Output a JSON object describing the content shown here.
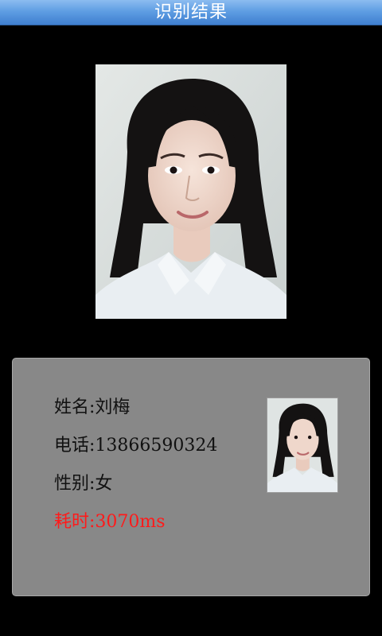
{
  "header": {
    "title": "识别结果"
  },
  "result": {
    "name_label": "姓名:",
    "name_value": "刘梅",
    "phone_label": "电话:",
    "phone_value": "13866590324",
    "gender_label": "性别:",
    "gender_value": "女",
    "time_label": "耗时:",
    "time_value": "3070ms"
  },
  "colors": {
    "header_bar": "#5f9ee3",
    "card_background": "#888888",
    "time_text": "#ff1a1a"
  }
}
